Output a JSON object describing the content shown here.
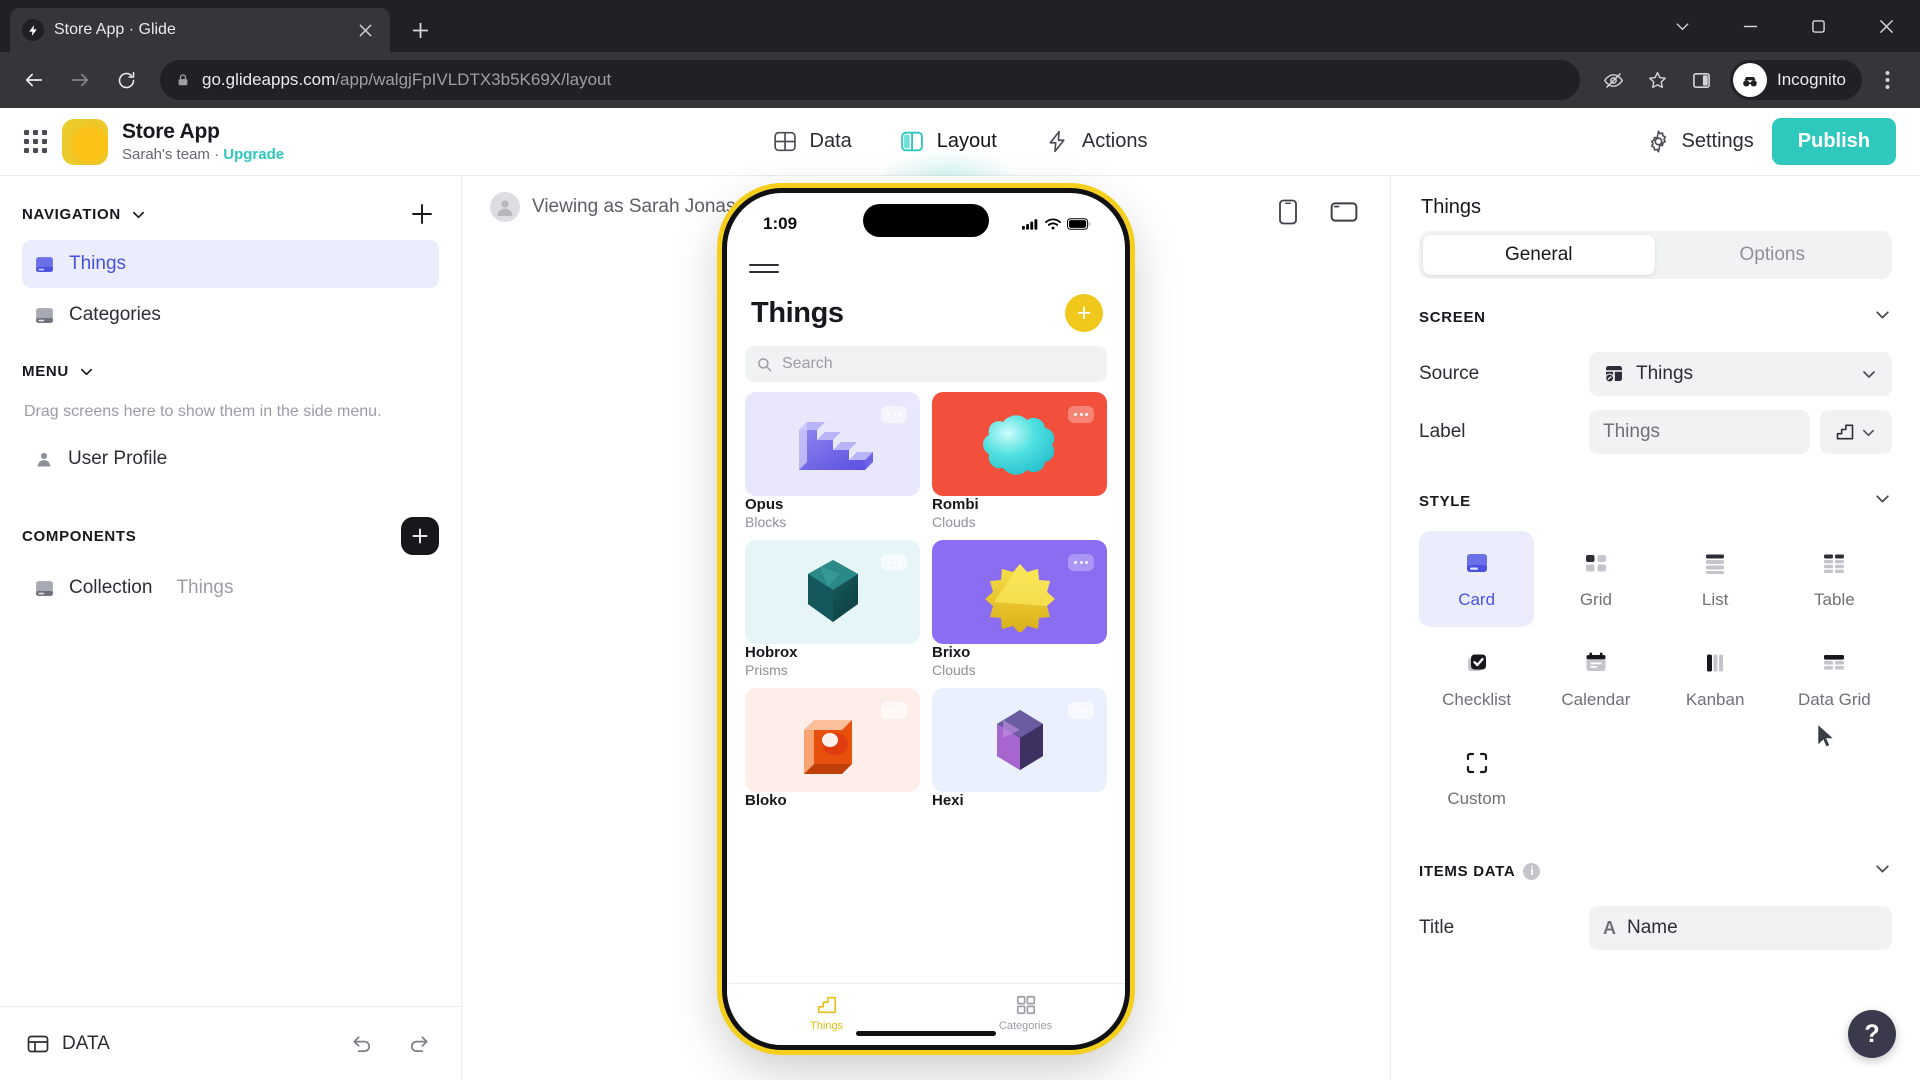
{
  "browser": {
    "tab": {
      "title": "Store App · Glide",
      "favicon_icon": "glide-bolt-icon",
      "close_icon": "close-icon"
    },
    "new_tab_icon": "plus-icon",
    "window_controls": [
      "chevron-down-icon",
      "minimize-icon",
      "maximize-icon",
      "close-window-icon"
    ],
    "back_icon": "arrow-left-icon",
    "forward_icon": "arrow-right-icon",
    "reload_icon": "reload-icon",
    "lock_icon": "lock-icon",
    "url_host": "go.glideapps.com",
    "url_path": "/app/walgjFpIVLDTX3b5K69X/layout",
    "toolbar_icons": [
      "eye-off-icon",
      "bookmark-star-icon",
      "side-panel-icon"
    ],
    "profile_label": "Incognito",
    "menu_icon": "three-dot-menu-icon"
  },
  "glide_header": {
    "apps_grid_icon": "apps-grid-icon",
    "app_name": "Store App",
    "team_label": "Sarah's team",
    "separator": "·",
    "upgrade_label": "Upgrade",
    "tabs": [
      {
        "label": "Data",
        "icon": "data-table-icon",
        "active": false
      },
      {
        "label": "Layout",
        "icon": "layout-panels-icon",
        "active": true
      },
      {
        "label": "Actions",
        "icon": "lightning-bolt-icon",
        "active": false
      }
    ],
    "settings_label": "Settings",
    "settings_icon": "gear-icon",
    "publish_label": "Publish",
    "publish_color": "#2ec8bd"
  },
  "sidebar": {
    "navigation": {
      "title": "NAVIGATION",
      "chevron_icon": "chevron-down-icon",
      "add_icon": "plus-icon",
      "items": [
        {
          "label": "Things",
          "icon": "screen-card-icon",
          "active": true
        },
        {
          "label": "Categories",
          "icon": "screen-card-icon",
          "active": false
        }
      ]
    },
    "menu": {
      "title": "MENU",
      "chevron_icon": "chevron-down-icon",
      "hint": "Drag screens here to show them in the side menu.",
      "items": [
        {
          "label": "User Profile",
          "icon": "user-avatar-icon"
        }
      ]
    },
    "components": {
      "title": "COMPONENTS",
      "add_icon": "plus-icon",
      "items": [
        {
          "label": "Collection",
          "sub": "Things",
          "icon": "collection-icon"
        }
      ]
    },
    "footer": {
      "data_label": "DATA",
      "data_icon": "data-table-icon",
      "undo_icon": "undo-icon",
      "redo_icon": "redo-icon"
    }
  },
  "canvas": {
    "viewing_as_label": "Viewing as Sarah Jonas",
    "viewing_as_chevron": "chevron-down-icon",
    "avatar_icon": "user-avatar-icon",
    "device_phone_icon": "phone-device-icon",
    "device_tablet_icon": "tablet-device-icon",
    "cursor_icon": "mouse-cursor-icon"
  },
  "phone": {
    "status_time": "1:09",
    "status_icons": [
      "cellular-signal-icon",
      "wifi-icon",
      "battery-icon"
    ],
    "menu_icon": "hamburger-menu-icon",
    "screen_title": "Things",
    "add_icon": "plus-icon",
    "search_placeholder": "Search",
    "search_icon": "search-icon",
    "cards": [
      {
        "name": "Opus",
        "sub": "Blocks",
        "bg": "#e9e7fb",
        "shape": "stairs",
        "dots_icon": "more-options-icon"
      },
      {
        "name": "Rombi",
        "sub": "Clouds",
        "bg": "#f2503c",
        "shape": "cloud",
        "dots_icon": "more-options-icon"
      },
      {
        "name": "Hobrox",
        "sub": "Prisms",
        "bg": "#e6f6f8",
        "shape": "polyhedron",
        "dots_icon": "more-options-icon"
      },
      {
        "name": "Brixo",
        "sub": "Clouds",
        "bg": "#8b6df2",
        "shape": "star",
        "dots_icon": "more-options-icon"
      },
      {
        "name": "Bloko",
        "sub": "",
        "bg": "#fdeeea",
        "shape": "holecube",
        "dots_icon": "more-options-icon"
      },
      {
        "name": "Hexi",
        "sub": "",
        "bg": "#eaf0fd",
        "shape": "hexprism",
        "dots_icon": "more-options-icon"
      }
    ],
    "tabbar": [
      {
        "label": "Things",
        "icon": "stairs-icon",
        "active": true
      },
      {
        "label": "Categories",
        "icon": "grid-squares-icon",
        "active": false
      }
    ]
  },
  "right_panel": {
    "title": "Things",
    "tabs": [
      {
        "label": "General",
        "active": true
      },
      {
        "label": "Options",
        "active": false
      }
    ],
    "screen": {
      "title": "SCREEN",
      "chevron_icon": "chevron-down-icon",
      "source_label": "Source",
      "source_value": "Things",
      "source_icon": "table-source-icon",
      "source_chevron": "chevron-down-icon",
      "label_label": "Label",
      "label_value": "Things",
      "label_icon": "stairs-icon",
      "label_chevron": "chevron-down-icon"
    },
    "style": {
      "title": "STYLE",
      "chevron_icon": "chevron-down-icon",
      "options": [
        {
          "label": "Card",
          "icon": "card-style-icon",
          "active": true
        },
        {
          "label": "Grid",
          "icon": "grid-style-icon",
          "active": false
        },
        {
          "label": "List",
          "icon": "list-style-icon",
          "active": false
        },
        {
          "label": "Table",
          "icon": "table-style-icon",
          "active": false
        },
        {
          "label": "Checklist",
          "icon": "checklist-style-icon",
          "active": false
        },
        {
          "label": "Calendar",
          "icon": "calendar-style-icon",
          "active": false
        },
        {
          "label": "Kanban",
          "icon": "kanban-style-icon",
          "active": false
        },
        {
          "label": "Data Grid",
          "icon": "datagrid-style-icon",
          "active": false
        },
        {
          "label": "Custom",
          "icon": "custom-style-icon",
          "active": false
        }
      ]
    },
    "items_data": {
      "title": "ITEMS DATA",
      "info_icon": "info-icon",
      "chevron_icon": "chevron-down-icon",
      "title_label": "Title",
      "title_value": "Name",
      "title_type_icon": "text-type-icon"
    },
    "help_label": "?"
  }
}
